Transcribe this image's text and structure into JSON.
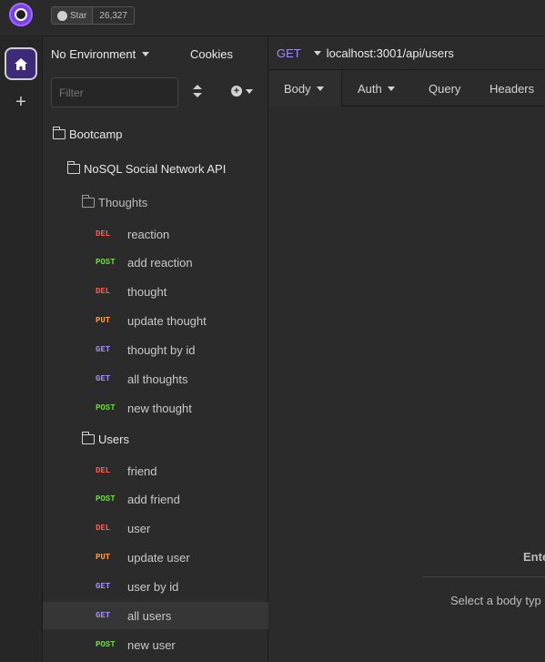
{
  "github": {
    "star_label": "Star",
    "star_count": "26,327"
  },
  "sidebar": {
    "environment": "No Environment",
    "cookies_label": "Cookies",
    "filter_placeholder": "Filter",
    "tree": {
      "workspace": "Bootcamp",
      "collection": "NoSQL Social Network API",
      "folders": [
        {
          "name": "Thoughts",
          "requests": [
            {
              "method": "DEL",
              "name": "reaction"
            },
            {
              "method": "POST",
              "name": "add reaction"
            },
            {
              "method": "DEL",
              "name": "thought"
            },
            {
              "method": "PUT",
              "name": "update thought"
            },
            {
              "method": "GET",
              "name": "thought by id"
            },
            {
              "method": "GET",
              "name": "all thoughts"
            },
            {
              "method": "POST",
              "name": "new thought"
            }
          ]
        },
        {
          "name": "Users",
          "requests": [
            {
              "method": "DEL",
              "name": "friend"
            },
            {
              "method": "POST",
              "name": "add friend"
            },
            {
              "method": "DEL",
              "name": "user"
            },
            {
              "method": "PUT",
              "name": "update user"
            },
            {
              "method": "GET",
              "name": "user by id"
            },
            {
              "method": "GET",
              "name": "all users",
              "active": true
            },
            {
              "method": "POST",
              "name": "new user"
            }
          ]
        }
      ]
    }
  },
  "request": {
    "method": "GET",
    "url": "localhost:3001/api/users",
    "tabs": {
      "body": "Body",
      "auth": "Auth",
      "query": "Query",
      "headers": "Headers"
    },
    "empty_title": "Ente",
    "empty_hint": "Select a body typ"
  },
  "colors": {
    "DEL": "#ff5a4f",
    "POST": "#6bdc3b",
    "PUT": "#ff9a3c",
    "GET": "#a48cf5",
    "accent": "#7a3df0"
  }
}
